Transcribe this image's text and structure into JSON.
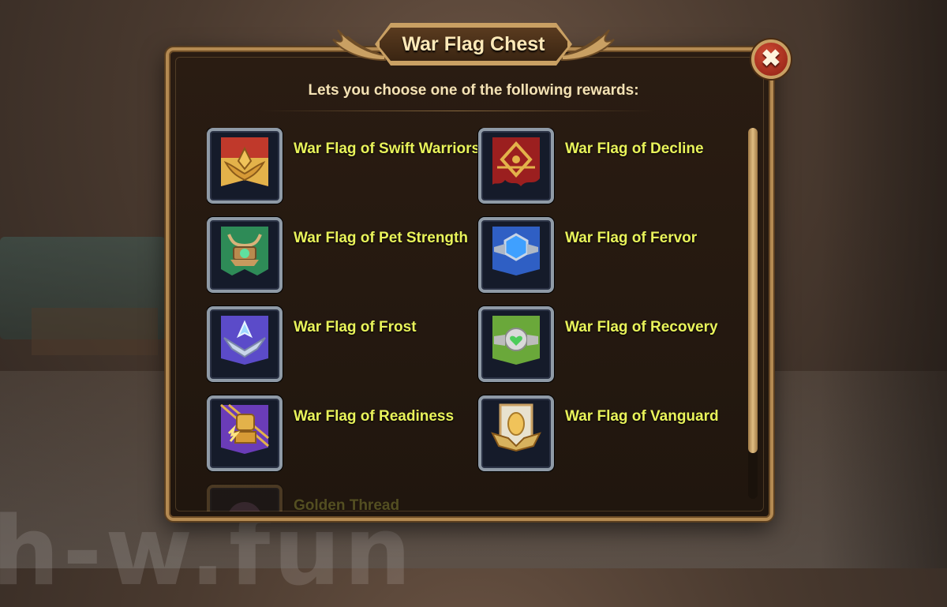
{
  "window": {
    "title": "War Flag Chest",
    "close_icon": "close-icon",
    "close_symbol": "✖"
  },
  "subtitle": "Lets you choose one of the following rewards:",
  "rewards": [
    {
      "name": "War Flag of Swift Warriors",
      "icon": "swift-warriors-flag-icon",
      "color": "#c0392b"
    },
    {
      "name": "War Flag of Decline",
      "icon": "decline-flag-icon",
      "color": "#9b1f1f"
    },
    {
      "name": "War Flag of Pet Strength",
      "icon": "pet-strength-flag-icon",
      "color": "#2e8b57"
    },
    {
      "name": "War Flag of Fervor",
      "icon": "fervor-flag-icon",
      "color": "#2f5fc4"
    },
    {
      "name": "War Flag of Frost",
      "icon": "frost-flag-icon",
      "color": "#5b4bc9"
    },
    {
      "name": "War Flag of Recovery",
      "icon": "recovery-flag-icon",
      "color": "#6aa83a"
    },
    {
      "name": "War Flag of Readiness",
      "icon": "readiness-flag-icon",
      "color": "#6a3cb8"
    },
    {
      "name": "War Flag of Vanguard",
      "icon": "vanguard-flag-icon",
      "color": "#e8e2cf"
    },
    {
      "name": "Golden Thread",
      "icon": "golden-thread-icon",
      "color": "#7a5a8a"
    }
  ],
  "watermark": "h-w.fun"
}
